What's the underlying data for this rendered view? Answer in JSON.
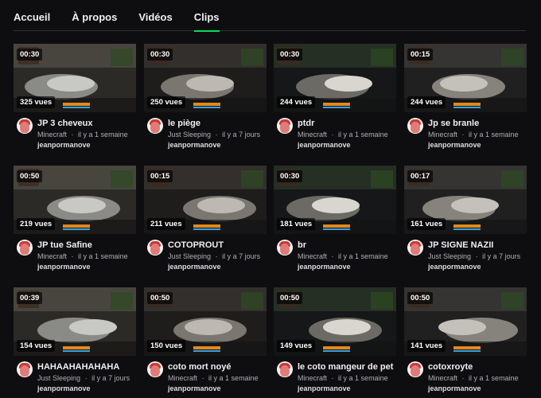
{
  "tabs": [
    "Accueil",
    "À propos",
    "Vidéos",
    "Clips"
  ],
  "active_tab": "Clips",
  "meta_separator": "·",
  "clips": [
    {
      "duration": "00:30",
      "views": "325 vues",
      "title": "JP 3 cheveux",
      "category": "Minecraft",
      "age": "il y a 1 semaine",
      "channel": "jeanpormanove"
    },
    {
      "duration": "00:30",
      "views": "250 vues",
      "title": "le piège",
      "category": "Just Sleeping",
      "age": "il y a 7 jours",
      "channel": "jeanpormanove"
    },
    {
      "duration": "00:30",
      "views": "244 vues",
      "title": "ptdr",
      "category": "Minecraft",
      "age": "il y a 1 semaine",
      "channel": "jeanpormanove"
    },
    {
      "duration": "00:15",
      "views": "244 vues",
      "title": "Jp se branle",
      "category": "Minecraft",
      "age": "il y a 1 semaine",
      "channel": "jeanpormanove"
    },
    {
      "duration": "00:50",
      "views": "219 vues",
      "title": "JP tue Safine",
      "category": "Minecraft",
      "age": "il y a 1 semaine",
      "channel": "jeanpormanove"
    },
    {
      "duration": "00:15",
      "views": "211 vues",
      "title": "COTOPROUT",
      "category": "Just Sleeping",
      "age": "il y a 7 jours",
      "channel": "jeanpormanove"
    },
    {
      "duration": "00:30",
      "views": "181 vues",
      "title": "br",
      "category": "Minecraft",
      "age": "il y a 1 semaine",
      "channel": "jeanpormanove"
    },
    {
      "duration": "00:17",
      "views": "161 vues",
      "title": "JP SIGNE NAZII",
      "category": "Just Sleeping",
      "age": "il y a 7 jours",
      "channel": "jeanpormanove"
    },
    {
      "duration": "00:39",
      "views": "154 vues",
      "title": "HAHAAHAHAHAHA",
      "category": "Just Sleeping",
      "age": "il y a 7 jours",
      "channel": "jeanpormanove"
    },
    {
      "duration": "00:50",
      "views": "150 vues",
      "title": "coto mort noyé",
      "category": "Minecraft",
      "age": "il y a 1 semaine",
      "channel": "jeanpormanove"
    },
    {
      "duration": "00:50",
      "views": "149 vues",
      "title": "le coto mangeur de pet",
      "category": "Minecraft",
      "age": "il y a 1 semaine",
      "channel": "jeanpormanove"
    },
    {
      "duration": "00:50",
      "views": "141 vues",
      "title": "cotoxroyte",
      "category": "Minecraft",
      "age": "il y a 1 semaine",
      "channel": "jeanpormanove"
    }
  ]
}
